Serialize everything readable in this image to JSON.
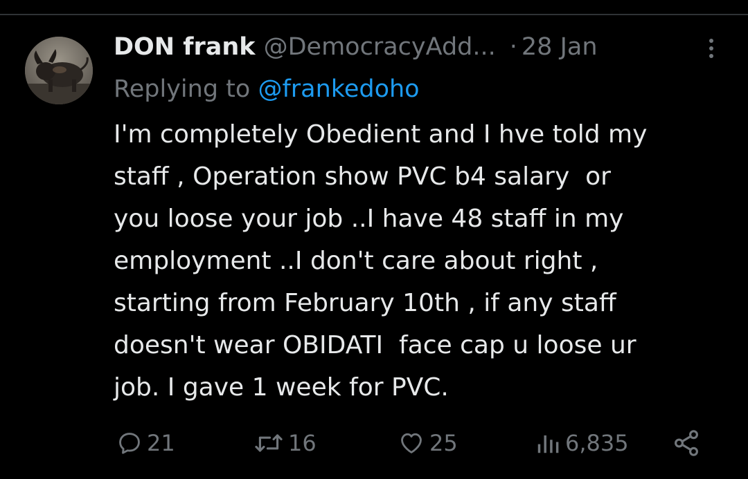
{
  "author": {
    "display_name": "DON frank",
    "handle": "@DemocracyAdd...",
    "separator": "·",
    "date": "28 Jan",
    "avatar_icon": "bull-statue-avatar"
  },
  "reply": {
    "prefix": "Replying to ",
    "handle": "@frankedoho"
  },
  "tweet": {
    "lines": [
      "I'm completely Obedient and I hve told my",
      "staff , Operation show PVC b4 salary  or",
      "you loose your job ..I have 48 staff in my",
      "employment ..I don't care about right ,",
      "starting from February 10th , if any staff",
      "doesn't wear OBIDATI  face cap u loose ur",
      "job. I gave 1 week for PVC."
    ]
  },
  "actions": {
    "replies": "21",
    "retweets": "16",
    "likes": "25",
    "views": "6,835",
    "share_icon": "share-icon"
  },
  "colors": {
    "background": "#000000",
    "text": "#e7e9ea",
    "muted": "#71767b",
    "accent": "#1d9bf0",
    "divider": "#2f3336"
  }
}
